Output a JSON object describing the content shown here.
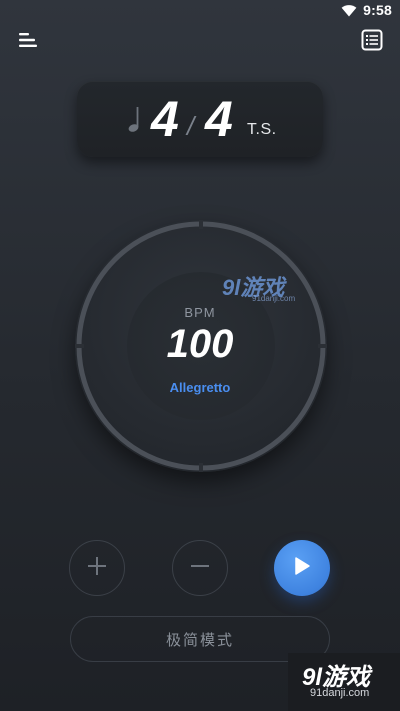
{
  "status_bar": {
    "time": "9:58",
    "wifi_icon": "wifi-icon"
  },
  "toolbar": {
    "menu_icon": "menu-icon",
    "list_icon": "list-icon"
  },
  "time_signature": {
    "note_icon": "quarter-note-icon",
    "beats": "4",
    "separator": "/",
    "unit": "4",
    "label": "T.S."
  },
  "tempo": {
    "bpm_label": "BPM",
    "bpm_value": "100",
    "tempo_name": "Allegretto"
  },
  "controls": {
    "plus_icon": "plus-icon",
    "minus_icon": "minus-icon",
    "play_icon": "play-icon",
    "simple_mode_label": "极简模式"
  },
  "watermarks": {
    "dial_logo": "9l游戏",
    "dial_logo_sub": "91danji.com",
    "corner_logo": "9l游戏",
    "corner_logo_sub": "91danji.com"
  },
  "colors": {
    "accent": "#4a8ef0",
    "background": "#2a2e34",
    "card": "#212428"
  }
}
